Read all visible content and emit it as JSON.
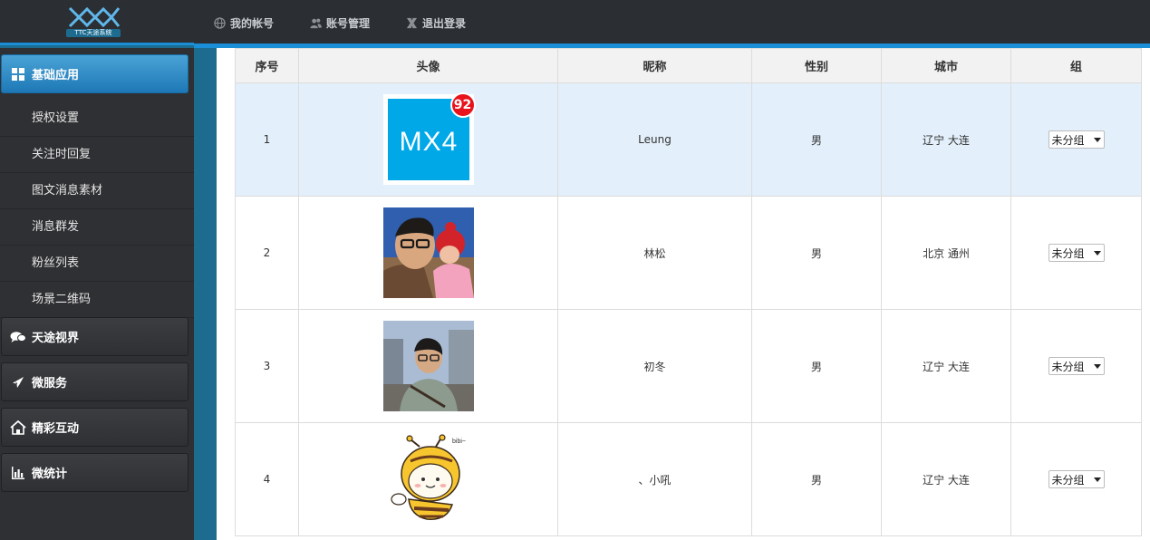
{
  "header": {
    "logo_text": "TTC天途系统",
    "nav": [
      {
        "label": "我的帐号",
        "icon": "globe-icon"
      },
      {
        "label": "账号管理",
        "icon": "users-icon"
      },
      {
        "label": "退出登录",
        "icon": "logout-x-icon"
      }
    ]
  },
  "sidebar": {
    "active_group": {
      "label": "基础应用",
      "icon": "grid-icon"
    },
    "subitems": [
      "授权设置",
      "关注时回复",
      "图文消息素材",
      "消息群发",
      "粉丝列表",
      "场景二维码"
    ],
    "groups": [
      {
        "label": "天途视界",
        "icon": "chat-bubbles-icon"
      },
      {
        "label": "微服务",
        "icon": "rocket-icon"
      },
      {
        "label": "精彩互动",
        "icon": "home-icon"
      },
      {
        "label": "微统计",
        "icon": "bar-chart-icon"
      }
    ]
  },
  "table": {
    "columns": [
      "序号",
      "头像",
      "昵称",
      "性别",
      "城市",
      "组"
    ],
    "rows": [
      {
        "index": "1",
        "avatar": "mx4-logo-avatar",
        "avatar_text": "MX4",
        "badge": "92",
        "nickname": "Leung",
        "gender": "男",
        "city": "辽宁 大连",
        "group": "未分组"
      },
      {
        "index": "2",
        "avatar": "photo-man-with-child-avatar",
        "nickname": "林松",
        "gender": "男",
        "city": "北京 通州",
        "group": "未分组"
      },
      {
        "index": "3",
        "avatar": "photo-young-man-avatar",
        "nickname": "初冬",
        "gender": "男",
        "city": "辽宁 大连",
        "group": "未分组"
      },
      {
        "index": "4",
        "avatar": "cartoon-bee-avatar",
        "avatar_text": "bibi~",
        "nickname": "、小吼",
        "gender": "男",
        "city": "辽宁 大连",
        "group": "未分组"
      }
    ]
  }
}
